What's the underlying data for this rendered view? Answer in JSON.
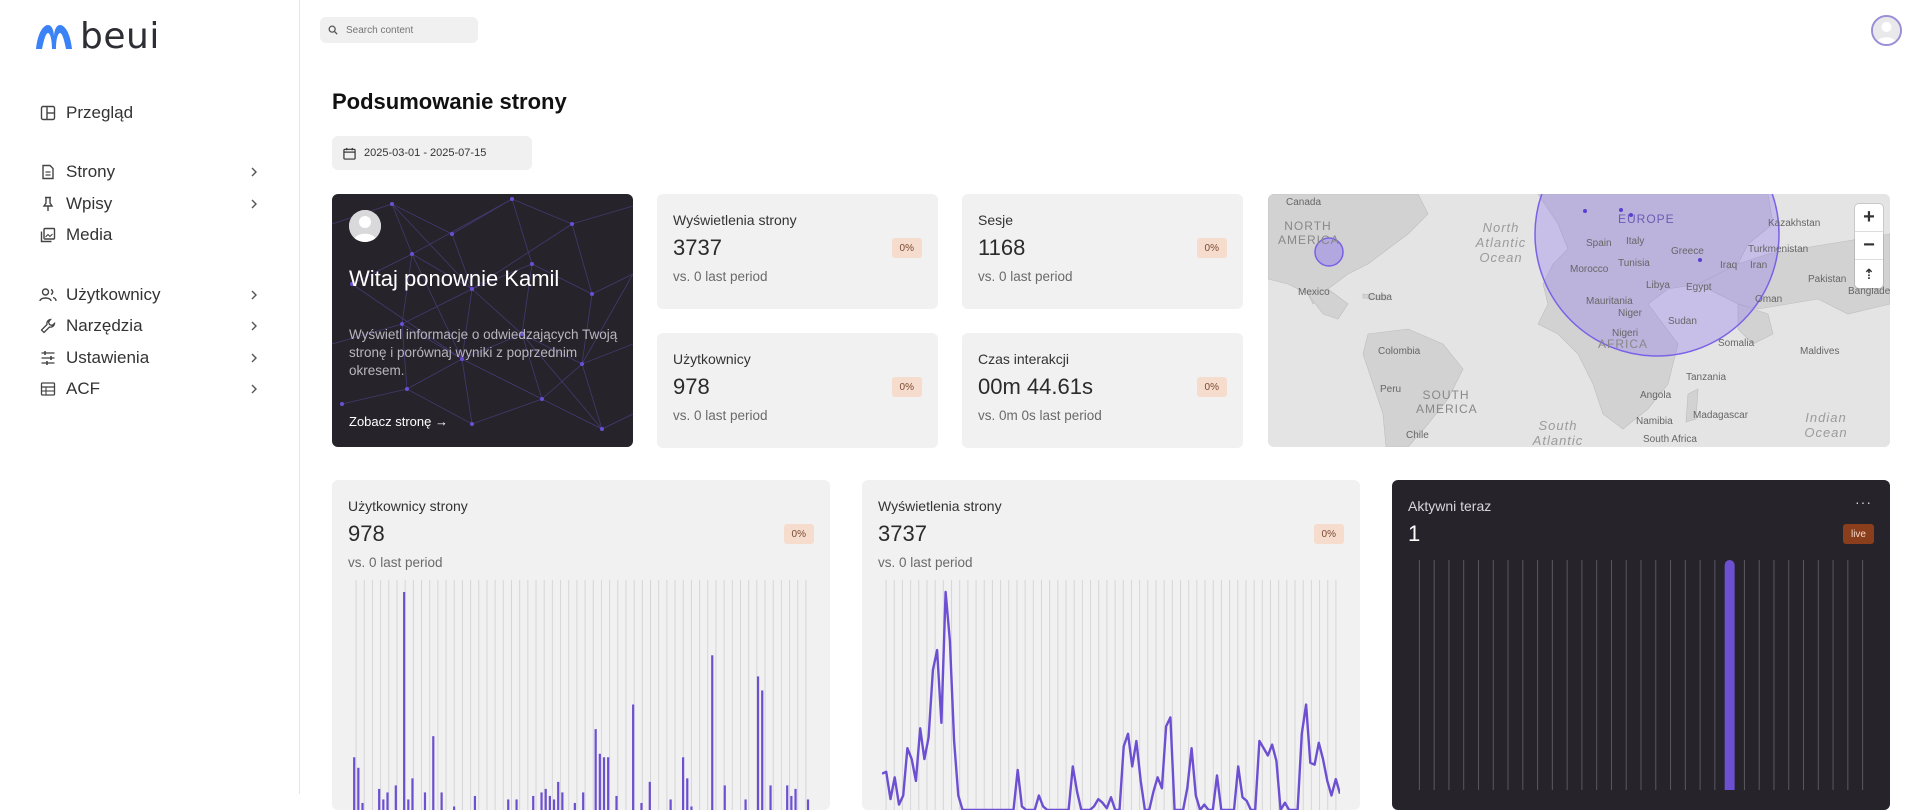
{
  "brand": {
    "name": "beui",
    "accent": "#3b82f6"
  },
  "sidebar": {
    "items": [
      {
        "label": "Przegląd",
        "icon": "layout-icon",
        "has_children": false
      },
      {
        "label": "Strony",
        "icon": "file-icon",
        "has_children": true
      },
      {
        "label": "Wpisy",
        "icon": "pin-icon",
        "has_children": true
      },
      {
        "label": "Media",
        "icon": "image-icon",
        "has_children": false
      },
      {
        "label": "Użytkownicy",
        "icon": "users-icon",
        "has_children": true
      },
      {
        "label": "Narzędzia",
        "icon": "wrench-icon",
        "has_children": true
      },
      {
        "label": "Ustawienia",
        "icon": "sliders-icon",
        "has_children": true
      },
      {
        "label": "ACF",
        "icon": "table-icon",
        "has_children": true
      }
    ]
  },
  "search": {
    "placeholder": "Search content"
  },
  "page": {
    "title": "Podsumowanie strony",
    "date_range": "2025-03-01 - 2025-07-15"
  },
  "welcome": {
    "title": "Witaj ponownie Kamil",
    "description": "Wyświetl informacje o odwiedzających Twoją stronę i porównaj wyniki z poprzednim okresem.",
    "link": "Zobacz stronę →"
  },
  "stats": [
    {
      "label": "Wyświetlenia strony",
      "value": "3737",
      "badge": "0%",
      "sub": "vs. 0 last period"
    },
    {
      "label": "Sesje",
      "value": "1168",
      "badge": "0%",
      "sub": "vs. 0 last period"
    },
    {
      "label": "Użytkownicy",
      "value": "978",
      "badge": "0%",
      "sub": "vs. 0 last period"
    },
    {
      "label": "Czas interakcji",
      "value": "00m 44.61s",
      "badge": "0%",
      "sub": "vs. 0m 0s last period"
    }
  ],
  "map": {
    "controls": {
      "zoom_in": "+",
      "zoom_out": "−",
      "reset": "⇡"
    },
    "labels": {
      "canada": "Canada",
      "north_america": "NORTH AMERICA",
      "mexico": "Mexico",
      "cuba": "Cuba",
      "colombia": "Colombia",
      "peru": "Peru",
      "south_america": "SOUTH AMERICA",
      "chile": "Chile",
      "north_atlantic": "North Atlantic Ocean",
      "south_atlantic": "South Atlantic",
      "europe": "EUROPE",
      "africa": "AFRICA",
      "kazakhstan": "Kazakhstan",
      "turkmenistan": "Turkmenistan",
      "iran": "Iran",
      "iraq": "Iraq",
      "pakistan": "Pakistan",
      "oman": "Oman",
      "somalia": "Somalia",
      "tanzania": "Tanzania",
      "angola": "Angola",
      "namibia": "Namibia",
      "madagascar": "Madagascar",
      "south_africa": "South Africa",
      "maldives": "Maldives",
      "bangladesh": "Banglades",
      "indian_ocean": "Indian Ocean",
      "mauritania": "Mauritania",
      "niger": "Niger",
      "sudan": "Sudan",
      "egypt": "Egypt",
      "libya": "Libya",
      "greece": "Greece",
      "nigeria": "Nigeri",
      "morocco": "Morocco",
      "spain": "Spain",
      "italy": "Italy",
      "tunisia": "Tunisia"
    }
  },
  "cards": {
    "users": {
      "label": "Użytkownicy strony",
      "value": "978",
      "badge": "0%",
      "sub": "vs. 0 last period"
    },
    "views": {
      "label": "Wyświetlenia strony",
      "value": "3737",
      "badge": "0%",
      "sub": "vs. 0 last period"
    },
    "active": {
      "label": "Aktywni teraz",
      "value": "1",
      "badge": "live",
      "menu": "···"
    }
  },
  "chart_data": [
    {
      "type": "bar",
      "color": "#6d4fd1",
      "values": [
        15,
        12,
        2,
        0,
        0,
        0,
        6,
        3,
        5,
        0,
        7,
        0,
        62,
        3,
        9,
        0,
        0,
        5,
        0,
        21,
        0,
        5,
        0,
        0,
        1,
        0,
        0,
        0,
        0,
        4,
        0,
        0,
        0,
        0,
        0,
        0,
        0,
        3,
        0,
        3,
        0,
        0,
        0,
        4,
        0,
        5,
        6,
        4,
        3,
        8,
        5,
        0,
        0,
        2,
        0,
        5,
        0,
        0,
        23,
        16,
        15,
        15,
        0,
        4,
        0,
        0,
        0,
        30,
        0,
        2,
        0,
        8,
        0,
        0,
        0,
        0,
        3,
        0,
        0,
        15,
        9,
        1,
        0,
        0,
        0,
        0,
        44,
        0,
        0,
        7,
        0,
        0,
        0,
        0,
        3,
        0,
        0,
        38,
        34,
        0,
        7,
        0,
        0,
        0,
        7,
        4,
        6,
        0,
        0,
        3
      ]
    },
    {
      "type": "line",
      "color": "#6d4fd1",
      "values": [
        20,
        21,
        6,
        18,
        3,
        8,
        34,
        28,
        16,
        45,
        28,
        40,
        77,
        88,
        48,
        120,
        93,
        38,
        8,
        0,
        0,
        0,
        0,
        0,
        0,
        0,
        0,
        0,
        0,
        0,
        0,
        0,
        22,
        2,
        0,
        0,
        0,
        8,
        2,
        0,
        0,
        0,
        0,
        0,
        0,
        24,
        10,
        0,
        0,
        0,
        2,
        6,
        4,
        1,
        7,
        0,
        0,
        35,
        42,
        24,
        38,
        16,
        0,
        0,
        10,
        18,
        12,
        46,
        51,
        0,
        0,
        0,
        12,
        34,
        8,
        0,
        3,
        0,
        0,
        19,
        0,
        0,
        0,
        0,
        24,
        7,
        5,
        0,
        0,
        38,
        34,
        30,
        36,
        27,
        0,
        4,
        0,
        0,
        0,
        42,
        58,
        26,
        25,
        37,
        28,
        16,
        8,
        17,
        9
      ]
    },
    {
      "type": "bar",
      "color": "#6d4fd1",
      "values": [
        0,
        0,
        0,
        0,
        0,
        0,
        0,
        0,
        0,
        0,
        0,
        0,
        0,
        0,
        0,
        0,
        0,
        0,
        0,
        0,
        0,
        1,
        0,
        0,
        0,
        0,
        0,
        0,
        0,
        0,
        0
      ]
    }
  ]
}
